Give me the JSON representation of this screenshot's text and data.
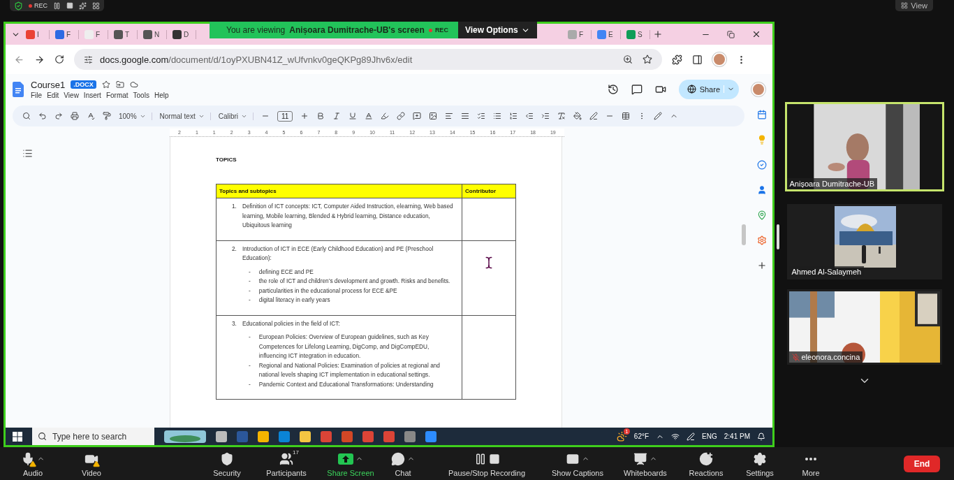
{
  "recording_strip": {
    "rec_label": "REC",
    "view_label": "View"
  },
  "share_banner": {
    "prefix": "You are viewing",
    "presenter": "Anișoara Dumitrache-UB's screen",
    "rec_label": "REC",
    "view_options": "View Options"
  },
  "browser": {
    "tabs": [
      {
        "kind": "gmail",
        "label": "I"
      },
      {
        "kind": "zm",
        "label": "F"
      },
      {
        "kind": "rg",
        "label": "F"
      },
      {
        "kind": "globe",
        "label": "T"
      },
      {
        "kind": "globe",
        "label": "N"
      },
      {
        "kind": "contact",
        "label": "D"
      },
      {
        "kind": "blank",
        "label": "F"
      },
      {
        "kind": "docs",
        "label": "E"
      },
      {
        "kind": "sheets",
        "label": "S"
      }
    ],
    "url_host": "docs.google.com",
    "url_path": "/document/d/1oyPXUBN41Z_wUfvnkv0geQKPg89Jhv6x/edit"
  },
  "docs": {
    "title": "Course1",
    "badge": ".DOCX",
    "menus": [
      "File",
      "Edit",
      "View",
      "Insert",
      "Format",
      "Tools",
      "Help"
    ],
    "share": "Share",
    "toolbar": {
      "zoom": "100%",
      "style": "Normal text",
      "font": "Calibri",
      "size": "11"
    },
    "ruler": [
      "2",
      "1",
      "1",
      "2",
      "3",
      "4",
      "5",
      "6",
      "7",
      "8",
      "9",
      "10",
      "11",
      "12",
      "13",
      "14",
      "15",
      "16",
      "17",
      "18",
      "19"
    ]
  },
  "document": {
    "heading": "TOPICS",
    "columns": [
      "Topics and subtopics",
      "Contributor"
    ],
    "rows": [
      {
        "number": "1.",
        "text": "Definition of ICT concepts: ICT, Computer Aided Instruction, elearning, Web based learning, Mobile learning, Blended & Hybrid learning, Distance education, Ubiquitous learning",
        "bullets": []
      },
      {
        "number": "2.",
        "text": "Introduction of ICT in ECE (Early Childhood Education) and PE (Preschool Education):",
        "bullets": [
          {
            "marker": "-",
            "text": "defining ECE and PE"
          },
          {
            "marker": "-",
            "text": "the role of ICT and children’s development and growth. Risks and benefits."
          },
          {
            "marker": "-",
            "text": "particularities in the educational process for ECE &PE"
          },
          {
            "marker": "-",
            "text": "digital literacy in early years"
          }
        ]
      },
      {
        "number": "3.",
        "text": "Educational policies in the field of ICT:",
        "bullets": [
          {
            "marker": "-",
            "text": "European Policies: Overview of European guidelines, such as Key Competences for Lifelong Learning, DigComp, and DigCompEDU, influencing ICT integration in education."
          },
          {
            "marker": "-",
            "text": "Regional and National Policies: Examination of policies at regional and national levels shaping ICT implementation in educational settings."
          },
          {
            "marker": "-",
            "text": "Pandemic Context and Educational Transformations: Understanding"
          }
        ]
      }
    ]
  },
  "taskbar": {
    "search_placeholder": "Type here to search",
    "weather_badge": "1",
    "temperature": "62°F",
    "language": "ENG",
    "time": "2:41 PM"
  },
  "participants": [
    {
      "name": "Anișoara Dumitrache-UB",
      "active": true,
      "muted": false
    },
    {
      "name": "Ahmed Al-Salaymeh",
      "active": false,
      "muted": false
    },
    {
      "name": "eleonora.concina",
      "active": false,
      "muted": true
    }
  ],
  "zoom_controls": [
    {
      "kind": "audio",
      "label": "Audio",
      "warning": true,
      "caret": true,
      "highlighted": false
    },
    {
      "kind": "video",
      "label": "Video",
      "warning": true,
      "caret": false,
      "highlighted": false
    },
    {
      "kind": "security",
      "label": "Security",
      "warning": false,
      "caret": false,
      "highlighted": false
    },
    {
      "kind": "participants",
      "label": "Participants",
      "count": "17",
      "warning": false,
      "caret": false,
      "highlighted": false
    },
    {
      "kind": "share",
      "label": "Share Screen",
      "warning": false,
      "caret": true,
      "highlighted": true
    },
    {
      "kind": "chat",
      "label": "Chat",
      "warning": false,
      "caret": true,
      "highlighted": false
    },
    {
      "kind": "record",
      "label": "Pause/Stop Recording",
      "warning": false,
      "caret": false,
      "highlighted": false
    },
    {
      "kind": "captions",
      "label": "Show Captions",
      "warning": false,
      "caret": true,
      "highlighted": false
    },
    {
      "kind": "whiteboards",
      "label": "Whiteboards",
      "warning": false,
      "caret": true,
      "highlighted": false
    },
    {
      "kind": "reactions",
      "label": "Reactions",
      "warning": false,
      "caret": false,
      "highlighted": false
    },
    {
      "kind": "settings",
      "label": "Settings",
      "warning": false,
      "caret": false,
      "highlighted": false
    },
    {
      "kind": "more",
      "label": "More",
      "warning": false,
      "caret": false,
      "highlighted": false
    }
  ],
  "end_button": "End"
}
